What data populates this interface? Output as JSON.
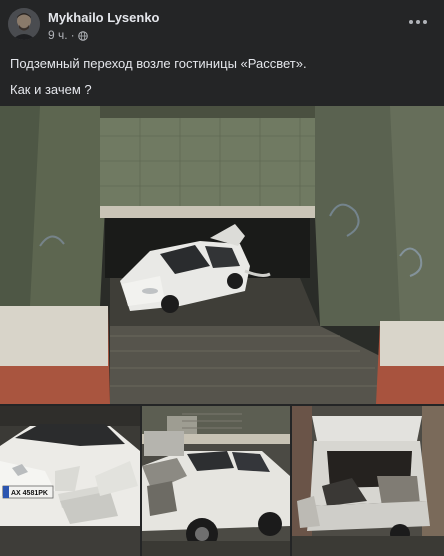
{
  "post": {
    "author": "Mykhailo Lysenko",
    "time": "9 ч.",
    "separator": "·",
    "privacy_icon": "globe-icon",
    "menu_icon": "more-options-icon",
    "text_line1": "Подземный переход возле гостиницы «Рассвет».",
    "text_line2": "Как и зачем ?"
  },
  "photos": {
    "plate": "AX 4581PK"
  },
  "colors": {
    "background": "#242526",
    "text_primary": "#e4e6eb",
    "text_secondary": "#b0b3b8"
  }
}
